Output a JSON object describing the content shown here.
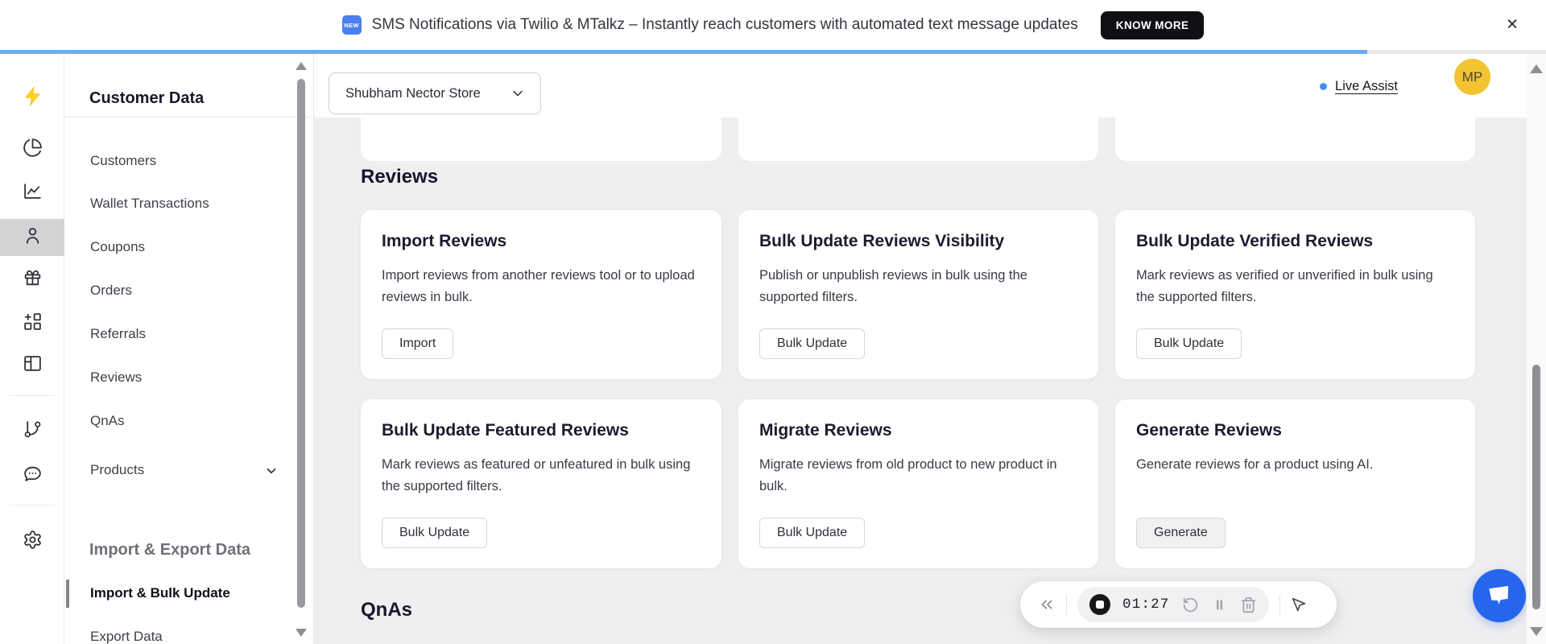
{
  "banner": {
    "badge_label": "NEW",
    "message": "SMS Notifications via Twilio & MTalkz – Instantly reach customers with automated text message updates",
    "cta_label": "KNOW MORE",
    "close_label": "✕",
    "progress_percent": 88
  },
  "header": {
    "store_name": "Shubham Nector Store",
    "live_assist_label": "Live Assist",
    "avatar_initials": "MP"
  },
  "sidebar": {
    "customer_data": {
      "title": "Customer Data",
      "items": [
        {
          "label": "Customers"
        },
        {
          "label": "Wallet Transactions"
        },
        {
          "label": "Coupons"
        },
        {
          "label": "Orders"
        },
        {
          "label": "Referrals"
        },
        {
          "label": "Reviews"
        },
        {
          "label": "QnAs"
        },
        {
          "label": "Products",
          "has_chevron": true
        }
      ]
    },
    "import_export": {
      "title": "Import & Export Data",
      "items": [
        {
          "label": "Import & Bulk Update",
          "active": true
        },
        {
          "label": "Export Data"
        }
      ]
    }
  },
  "content": {
    "reviews_title": "Reviews",
    "qnas_title": "QnAs",
    "cards": [
      {
        "title": "Import Reviews",
        "description": "Import reviews from another reviews tool or to upload reviews in bulk.",
        "button_label": "Import"
      },
      {
        "title": "Bulk Update Reviews Visibility",
        "description": "Publish or unpublish reviews in bulk using the supported filters.",
        "button_label": "Bulk Update"
      },
      {
        "title": "Bulk Update Verified Reviews",
        "description": "Mark reviews as verified or unverified in bulk using the supported filters.",
        "button_label": "Bulk Update"
      },
      {
        "title": "Bulk Update Featured Reviews",
        "description": "Mark reviews as featured or unfeatured in bulk using the supported filters.",
        "button_label": "Bulk Update"
      },
      {
        "title": "Migrate Reviews",
        "description": "Migrate reviews from old product to new product in bulk.",
        "button_label": "Bulk Update"
      },
      {
        "title": "Generate Reviews",
        "description": "Generate reviews for a product using AI.",
        "button_label": "Generate"
      }
    ]
  },
  "recorder": {
    "timer": "01:27",
    "icons": [
      "collapse-left",
      "stop-record",
      "restart",
      "pause",
      "trash",
      "cursor-mode"
    ]
  },
  "icons": {
    "rail": [
      "lightning-logo",
      "pie-chart",
      "line-chart",
      "user",
      "gift",
      "widgets",
      "layout",
      "git-branch",
      "chat",
      "settings"
    ]
  },
  "colors": {
    "progress_blue": "#6caee8",
    "brand_yellow": "#ffd21e",
    "avatar_yellow": "#f3c431",
    "live_assist_dot": "#4a8df0",
    "chat_fab_blue": "#2666ec",
    "cta_black": "#101014",
    "rail_active_bg": "#d3d3d5"
  }
}
